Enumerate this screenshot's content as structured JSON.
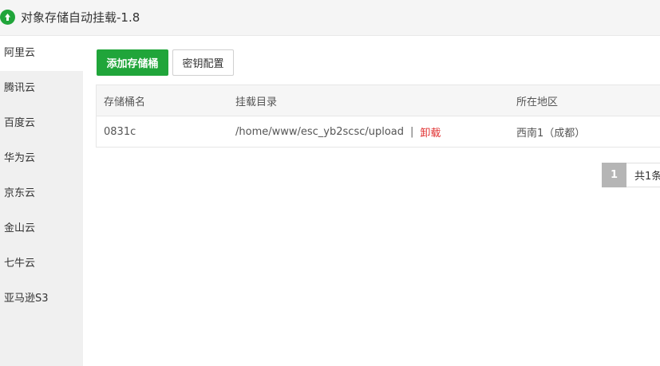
{
  "app": {
    "title": "对象存储自动挂载-1.8",
    "logo_icon": "cloud-upload-icon",
    "accent": "#20a53a"
  },
  "sidebar": {
    "items": [
      {
        "label": "阿里云",
        "active": true
      },
      {
        "label": "腾讯云"
      },
      {
        "label": "百度云"
      },
      {
        "label": "华为云"
      },
      {
        "label": "京东云"
      },
      {
        "label": "金山云"
      },
      {
        "label": "七牛云"
      },
      {
        "label": "亚马逊S3"
      }
    ]
  },
  "toolbar": {
    "add_label": "添加存储桶",
    "key_label": "密钥配置"
  },
  "table": {
    "headers": [
      "存储桶名",
      "挂载目录",
      "所在地区"
    ],
    "rows": [
      {
        "bucket": "0831c",
        "dir": "/home/www/esc_yb2scsc/upload",
        "sep": "|",
        "action": "卸载",
        "region": "西南1（成都）"
      }
    ]
  },
  "pagination": {
    "current": "1",
    "total_text": "共1条"
  }
}
